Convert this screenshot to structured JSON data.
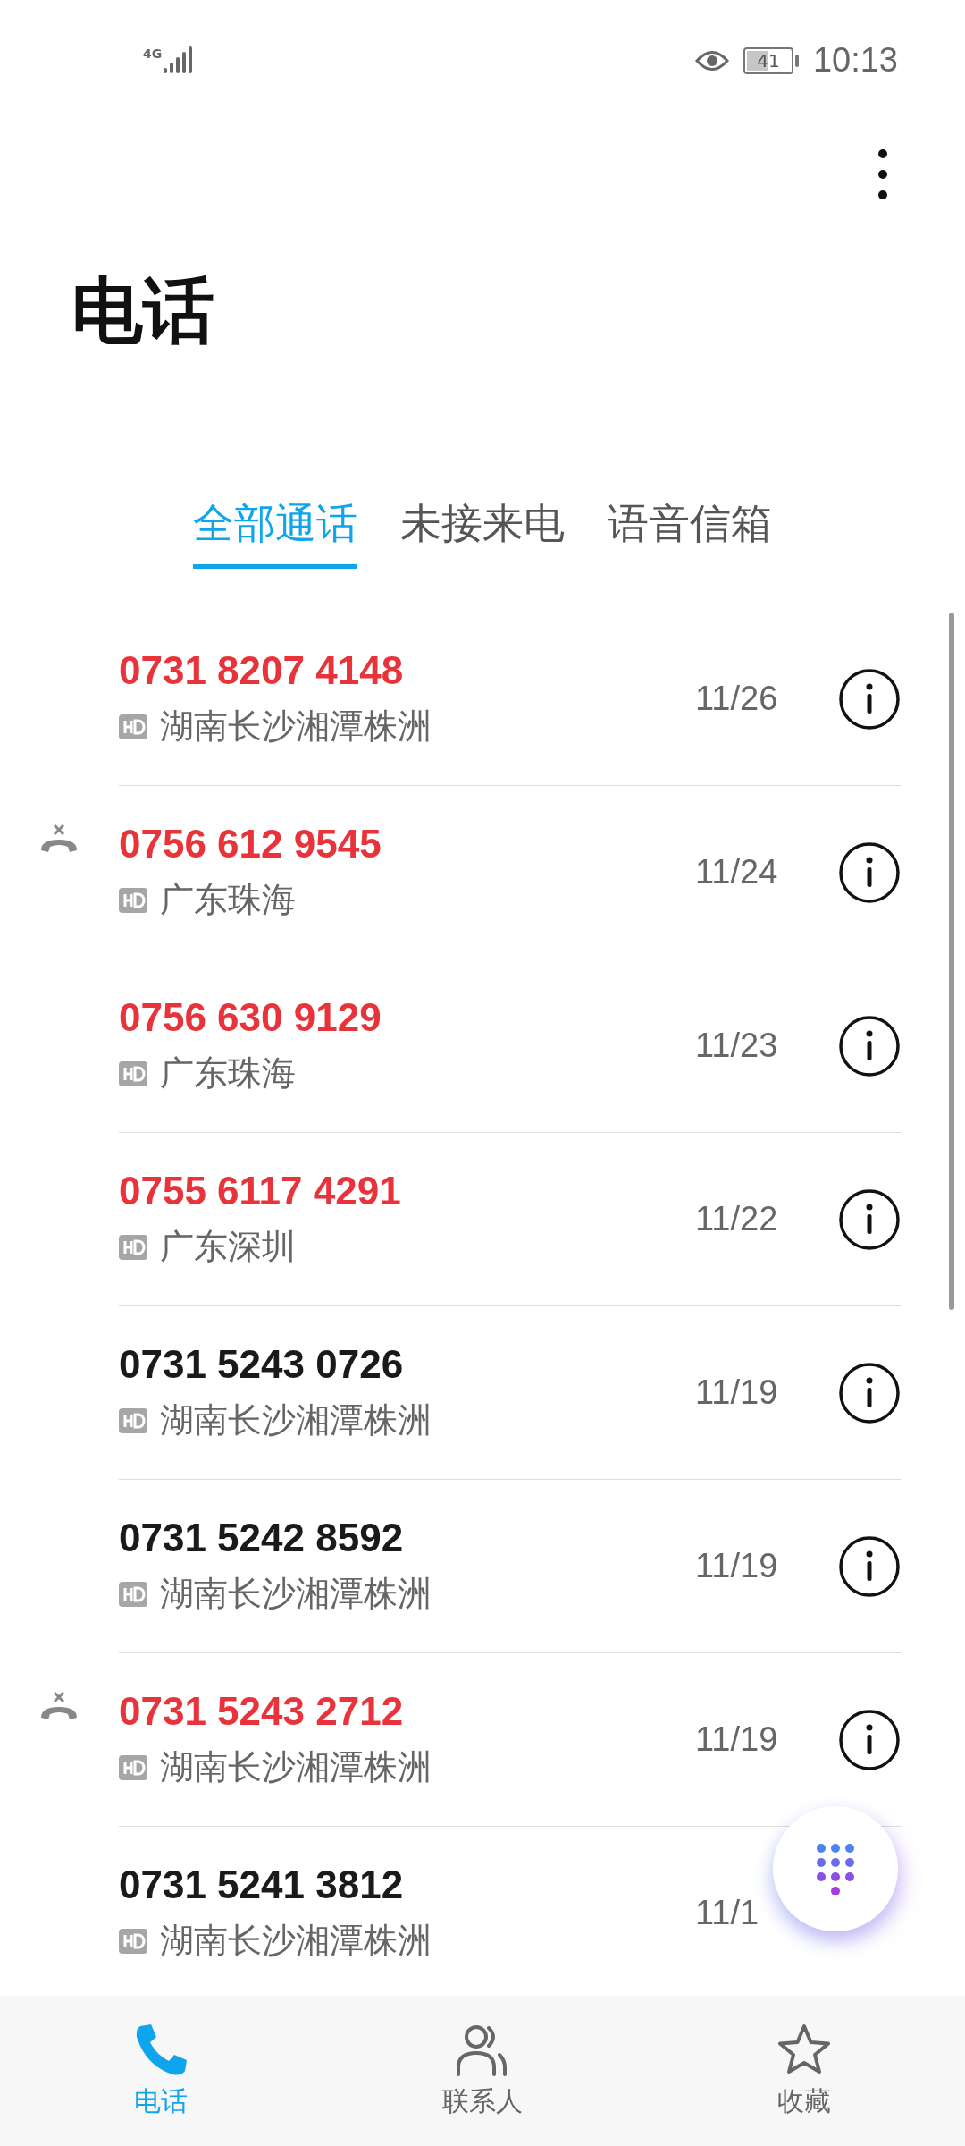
{
  "status_bar": {
    "network": "4G",
    "battery": "41",
    "time": "10:13"
  },
  "title": "电话",
  "tabs": [
    {
      "label": "全部通话",
      "selected": true
    },
    {
      "label": "未接来电",
      "selected": false
    },
    {
      "label": "语音信箱",
      "selected": false
    }
  ],
  "calls": [
    {
      "number": "0731 8207 4148",
      "location": "湖南长沙湘潭株洲",
      "date": "11/26",
      "missed": true,
      "declined": false,
      "info_button": true
    },
    {
      "number": "0756 612 9545",
      "location": "广东珠海",
      "date": "11/24",
      "missed": true,
      "declined": true,
      "info_button": true
    },
    {
      "number": "0756 630 9129",
      "location": "广东珠海",
      "date": "11/23",
      "missed": true,
      "declined": false,
      "info_button": true
    },
    {
      "number": "0755 6117 4291",
      "location": "广东深圳",
      "date": "11/22",
      "missed": true,
      "declined": false,
      "info_button": true
    },
    {
      "number": "0731 5243 0726",
      "location": "湖南长沙湘潭株洲",
      "date": "11/19",
      "missed": false,
      "declined": false,
      "info_button": true
    },
    {
      "number": "0731 5242 8592",
      "location": "湖南长沙湘潭株洲",
      "date": "11/19",
      "missed": false,
      "declined": false,
      "info_button": true
    },
    {
      "number": "0731 5243 2712",
      "location": "湖南长沙湘潭株洲",
      "date": "11/19",
      "missed": true,
      "declined": true,
      "info_button": true
    },
    {
      "number": "0731 5241 3812",
      "location": "湖南长沙湘潭株洲",
      "date": "11/1",
      "missed": false,
      "declined": false,
      "info_button": false
    }
  ],
  "bottom_nav": [
    {
      "label": "电话",
      "selected": true
    },
    {
      "label": "联系人",
      "selected": false
    },
    {
      "label": "收藏",
      "selected": false
    }
  ]
}
